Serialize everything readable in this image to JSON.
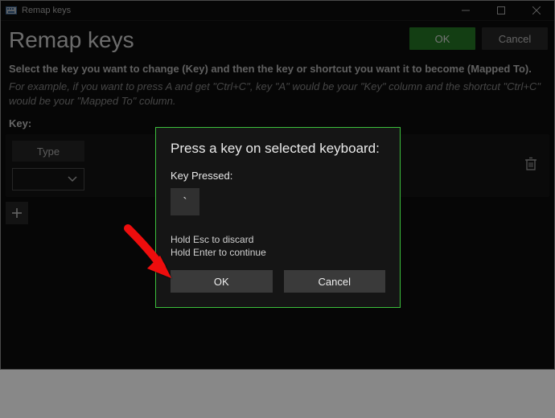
{
  "titlebar": {
    "title": "Remap keys"
  },
  "header": {
    "heading": "Remap keys",
    "ok": "OK",
    "cancel": "Cancel"
  },
  "desc": "Select the key you want to change (Key) and then the key or shortcut you want it to become (Mapped To).",
  "example": "For example, if you want to press A and get \"Ctrl+C\", key \"A\" would be your \"Key\" column and the shortcut \"Ctrl+C\" would be your \"Mapped To\" column.",
  "columns": {
    "key": "Key:"
  },
  "panel": {
    "type_button": "Type"
  },
  "modal": {
    "title": "Press a key on selected keyboard:",
    "label": "Key Pressed:",
    "key_value": "`",
    "hint1": "Hold Esc to discard",
    "hint2": "Hold Enter to continue",
    "ok": "OK",
    "cancel": "Cancel"
  }
}
